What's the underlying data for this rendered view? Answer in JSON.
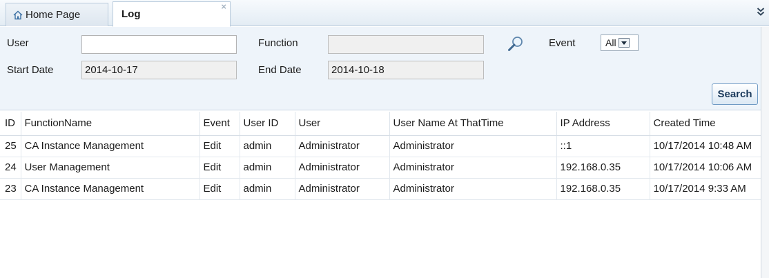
{
  "tabs": {
    "home_label": "Home Page",
    "log_label": "Log",
    "close_glyph": "×",
    "more_glyph": "»"
  },
  "filter": {
    "user_label": "User",
    "user_value": "",
    "function_label": "Function",
    "function_value": "",
    "event_label": "Event",
    "event_selected": "All",
    "start_date_label": "Start Date",
    "start_date_value": "2014-10-17",
    "end_date_label": "End Date",
    "end_date_value": "2014-10-18",
    "search_button": "Search"
  },
  "grid": {
    "columns": [
      "ID",
      "FunctionName",
      "Event",
      "User ID",
      "User",
      "User Name At ThatTime",
      "IP Address",
      "Created Time"
    ],
    "rows": [
      [
        "25",
        "CA Instance Management",
        "Edit",
        "admin",
        "Administrator",
        "Administrator",
        "::1",
        "10/17/2014 10:48 AM"
      ],
      [
        "24",
        "User Management",
        "Edit",
        "admin",
        "Administrator",
        "Administrator",
        "192.168.0.35",
        "10/17/2014 10:06 AM"
      ],
      [
        "23",
        "CA Instance Management",
        "Edit",
        "admin",
        "Administrator",
        "Administrator",
        "192.168.0.35",
        "10/17/2014 9:33 AM"
      ]
    ]
  },
  "colors": {
    "panel_bg": "#eef4fa",
    "tab_border": "#b9cbdc",
    "button_border": "#6f9ac4"
  }
}
